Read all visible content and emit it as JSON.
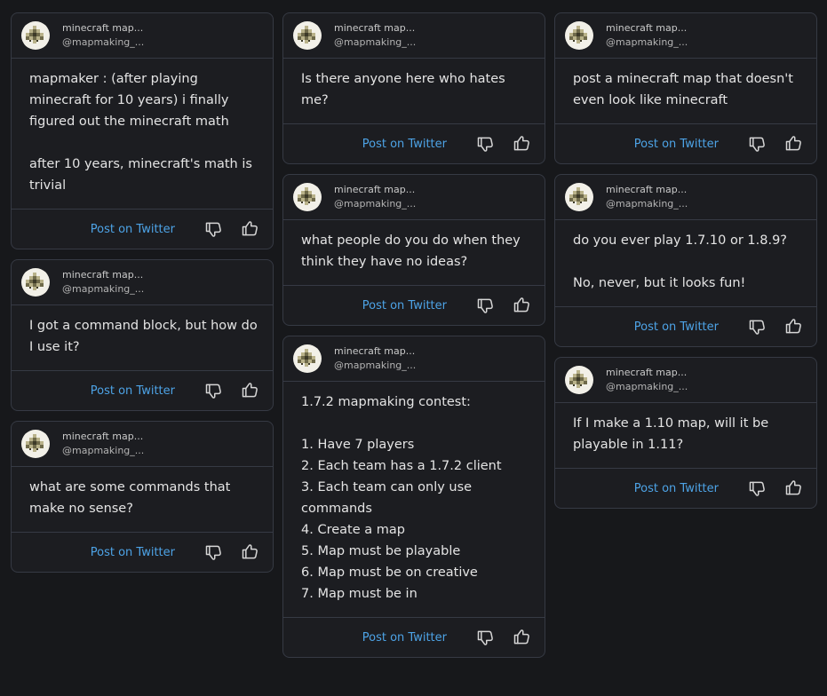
{
  "author": {
    "name": "minecraft map...",
    "handle": "@mapmaking_..."
  },
  "post_label": "Post on Twitter",
  "icons": {
    "avatar": "pixel-map-avatar-icon",
    "dislike": "thumbs-down-icon",
    "like": "thumbs-up-icon"
  },
  "colors": {
    "background": "#17181b",
    "card": "#1c1d21",
    "border": "#363a44",
    "link": "#4da3e6"
  },
  "columns": [
    [
      {
        "text": "mapmaker : (after playing minecraft for 10 years) i finally figured out the minecraft math\n\nafter 10 years, minecraft's math is trivial"
      },
      {
        "text": "I got a command block, but how do I use it?"
      },
      {
        "text": "what are some commands that make no sense?"
      }
    ],
    [
      {
        "text": "Is there anyone here who hates me?"
      },
      {
        "text": "what people do you do when they think they have no ideas?"
      },
      {
        "text": "1.7.2 mapmaking contest:\n\n1. Have 7 players\n2. Each team has a 1.7.2 client\n3. Each team can only use commands\n4. Create a map\n5. Map must be playable\n6. Map must be on creative\n7. Map must be in"
      }
    ],
    [
      {
        "text": "post a minecraft map that doesn't even look like minecraft"
      },
      {
        "text": "do you ever play 1.7.10 or 1.8.9?\n\nNo, never, but it looks fun!"
      },
      {
        "text": "If I make a 1.10 map, will it be playable in 1.11?"
      }
    ]
  ]
}
